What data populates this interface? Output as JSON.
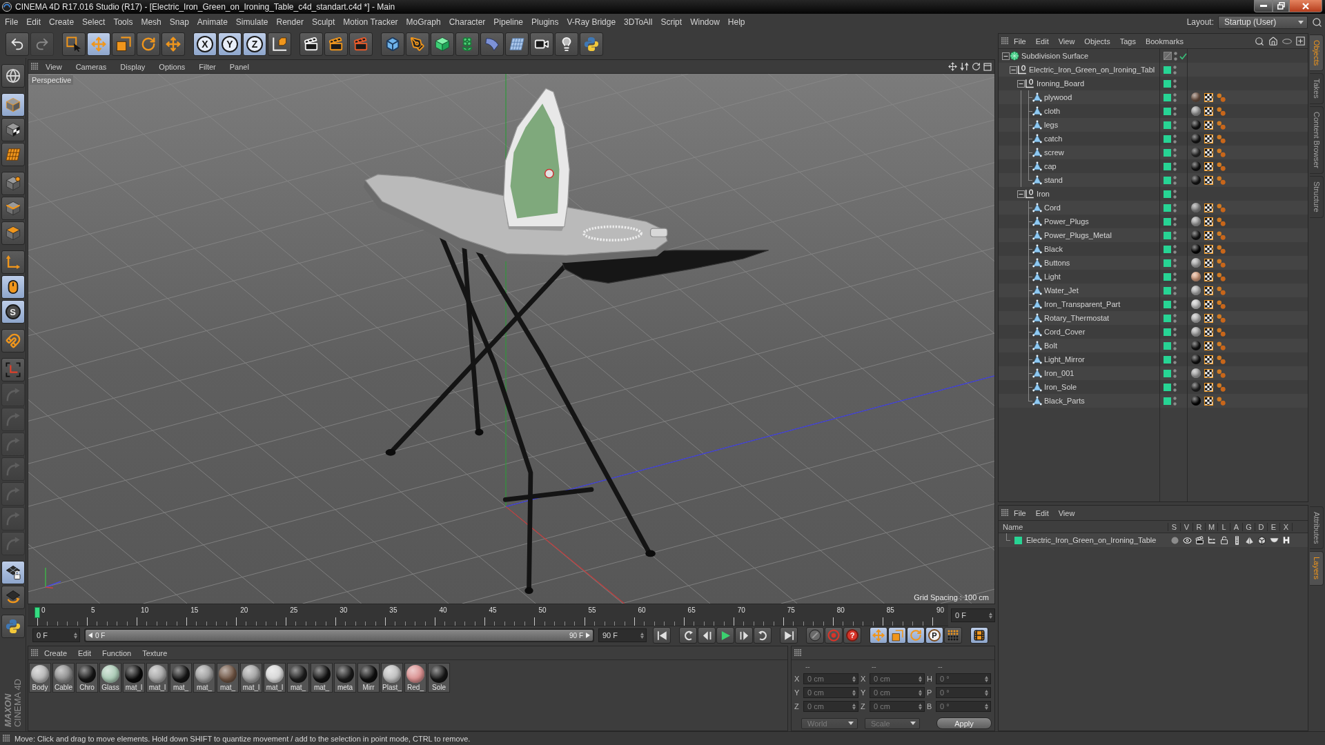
{
  "window": {
    "title": "CINEMA 4D R17.016 Studio (R17) - [Electric_Iron_Green_on_Ironing_Table_c4d_standart.c4d *] - Main"
  },
  "menu_bar": [
    "File",
    "Edit",
    "Create",
    "Select",
    "Tools",
    "Mesh",
    "Snap",
    "Animate",
    "Simulate",
    "Render",
    "Sculpt",
    "Motion Tracker",
    "MoGraph",
    "Character",
    "Pipeline",
    "Plugins",
    "V-Ray Bridge",
    "3DToAll",
    "Script",
    "Window",
    "Help"
  ],
  "layout": {
    "label": "Layout:",
    "value": "Startup (User)"
  },
  "toolbar": [
    [
      {
        "kind": "undo",
        "selected": false,
        "disabled": false
      },
      {
        "kind": "redo",
        "selected": false,
        "disabled": true
      }
    ],
    [
      {
        "kind": "select",
        "selected": false,
        "disabled": false
      },
      {
        "kind": "move",
        "selected": true,
        "disabled": false
      },
      {
        "kind": "scale",
        "selected": false,
        "disabled": false
      },
      {
        "kind": "rotate",
        "selected": false,
        "disabled": false
      },
      {
        "kind": "transform",
        "selected": false,
        "disabled": false
      }
    ],
    [
      {
        "kind": "axis",
        "label": "X",
        "selected": true,
        "disabled": false
      },
      {
        "kind": "axis",
        "label": "Y",
        "selected": true,
        "disabled": false
      },
      {
        "kind": "axis",
        "label": "Z",
        "selected": true,
        "disabled": false
      },
      {
        "kind": "coords",
        "selected": false,
        "disabled": false
      }
    ],
    [
      {
        "kind": "render_view",
        "selected": false,
        "disabled": false
      },
      {
        "kind": "render_picture",
        "selected": false,
        "disabled": false
      },
      {
        "kind": "render_settings",
        "selected": false,
        "disabled": false
      }
    ],
    [
      {
        "kind": "cube",
        "selected": false,
        "disabled": false
      },
      {
        "kind": "pen",
        "selected": false,
        "disabled": false
      },
      {
        "kind": "subdivision",
        "selected": false,
        "disabled": false
      },
      {
        "kind": "cloner",
        "selected": false,
        "disabled": false
      },
      {
        "kind": "deformer",
        "selected": false,
        "disabled": false
      },
      {
        "kind": "floor",
        "selected": false,
        "disabled": false
      },
      {
        "kind": "camera",
        "selected": false,
        "disabled": false
      },
      {
        "kind": "light",
        "selected": false,
        "disabled": false
      },
      {
        "kind": "python",
        "selected": false,
        "disabled": false
      }
    ]
  ],
  "tool_palette": [
    [
      {
        "kind": "globe",
        "selected": false,
        "disabled": false
      }
    ],
    [
      {
        "kind": "model",
        "selected": true,
        "disabled": false
      },
      {
        "kind": "texture",
        "selected": false,
        "disabled": false
      },
      {
        "kind": "workplane",
        "selected": false,
        "disabled": false
      }
    ],
    [
      {
        "kind": "points",
        "selected": false,
        "disabled": false
      },
      {
        "kind": "edges",
        "selected": false,
        "disabled": false
      },
      {
        "kind": "polygons",
        "selected": false,
        "disabled": false
      }
    ],
    [
      {
        "kind": "axis_mode",
        "selected": false,
        "disabled": false
      },
      {
        "kind": "tweak",
        "selected": true,
        "disabled": false
      },
      {
        "kind": "solo",
        "label": "S",
        "selected": true,
        "disabled": false
      }
    ],
    [
      {
        "kind": "snap",
        "selected": false,
        "disabled": false
      }
    ],
    [
      {
        "kind": "axes_bracket",
        "selected": false,
        "disabled": false
      },
      {
        "kind": "tool",
        "selected": false,
        "disabled": true
      },
      {
        "kind": "tool",
        "selected": false,
        "disabled": true
      },
      {
        "kind": "tool",
        "selected": false,
        "disabled": true
      },
      {
        "kind": "tool",
        "selected": false,
        "disabled": true
      },
      {
        "kind": "tool",
        "selected": false,
        "disabled": true
      },
      {
        "kind": "tool",
        "selected": false,
        "disabled": true
      },
      {
        "kind": "tool",
        "selected": false,
        "disabled": true
      }
    ],
    [
      {
        "kind": "grid_lock",
        "selected": true,
        "disabled": false
      },
      {
        "kind": "grid_rotate",
        "selected": false,
        "disabled": false
      }
    ],
    [
      {
        "kind": "python",
        "selected": false,
        "disabled": false
      }
    ]
  ],
  "viewport": {
    "menu": [
      "View",
      "Cameras",
      "Display",
      "Options",
      "Filter",
      "Panel"
    ],
    "camera": "Perspective",
    "grid_spacing": "Grid Spacing : 100 cm"
  },
  "timeline": {
    "ruler": [
      "0",
      "5",
      "10",
      "15",
      "20",
      "25",
      "30",
      "35",
      "40",
      "45",
      "50",
      "55",
      "60",
      "65",
      "70",
      "75",
      "80",
      "85",
      "90"
    ],
    "playhead": {
      "level": 0
    },
    "current_frame": "0 F",
    "start_frame": "0 F",
    "range": {
      "start": "0 F",
      "end": "90 F",
      "level": 1
    },
    "end_frame": "90 F",
    "transport": [
      [
        {
          "kind": "go_start",
          "selected": false
        }
      ],
      [
        {
          "kind": "prev_key",
          "selected": false
        },
        {
          "kind": "prev_frame",
          "selected": false
        },
        {
          "kind": "play",
          "selected": false
        },
        {
          "kind": "next_frame",
          "selected": false
        },
        {
          "kind": "next_key",
          "selected": false
        }
      ],
      [
        {
          "kind": "go_end",
          "selected": false
        }
      ],
      [
        {
          "kind": "key_off",
          "selected": false
        },
        {
          "kind": "record",
          "selected": false
        },
        {
          "kind": "autokey",
          "label": "?",
          "selected": false
        }
      ],
      [
        {
          "kind": "key_move",
          "selected": true
        },
        {
          "kind": "key_scale",
          "selected": true
        },
        {
          "kind": "key_rotate",
          "selected": true
        },
        {
          "kind": "key_param",
          "label": "P",
          "selected": true
        },
        {
          "kind": "key_points",
          "selected": false
        }
      ],
      [
        {
          "kind": "timeline",
          "selected": true
        }
      ]
    ]
  },
  "material_manager": {
    "menu": [
      "Create",
      "Edit",
      "Function",
      "Texture"
    ],
    "materials": [
      {
        "name": "Body",
        "color": "#b4b4b4"
      },
      {
        "name": "Cable",
        "color": "#8c8c8c"
      },
      {
        "name": "Chro",
        "color": "#151515"
      },
      {
        "name": "Glass",
        "color": "#a9c9b4"
      },
      {
        "name": "mat_l",
        "color": "#0a0a0a"
      },
      {
        "name": "mat_l",
        "color": "#a5a5a5"
      },
      {
        "name": "mat_",
        "color": "#141414"
      },
      {
        "name": "mat_",
        "color": "#9d9d9d"
      },
      {
        "name": "mat_",
        "color": "#6e5443"
      },
      {
        "name": "mat_l",
        "color": "#a0a0a0"
      },
      {
        "name": "mat_l",
        "color": "#d6d6d6"
      },
      {
        "name": "mat_",
        "color": "#1c1c1c"
      },
      {
        "name": "mat_",
        "color": "#121212"
      },
      {
        "name": "meta",
        "color": "#1a1a1a"
      },
      {
        "name": "Mirr",
        "color": "#0e0e0e"
      },
      {
        "name": "Plast_",
        "color": "#bdbdbd"
      },
      {
        "name": "Red_",
        "color": "#d98f8f"
      },
      {
        "name": "Sole",
        "color": "#151515"
      }
    ]
  },
  "coordinates": {
    "headers": [
      "--",
      "--",
      "--"
    ],
    "rows": [
      [
        {
          "label": "X",
          "value": "0 cm"
        },
        {
          "label": "X",
          "value": "0 cm"
        },
        {
          "label": "H",
          "value": "0 °"
        }
      ],
      [
        {
          "label": "Y",
          "value": "0 cm"
        },
        {
          "label": "Y",
          "value": "0 cm"
        },
        {
          "label": "P",
          "value": "0 °"
        }
      ],
      [
        {
          "label": "Z",
          "value": "0 cm"
        },
        {
          "label": "Z",
          "value": "0 cm"
        },
        {
          "label": "B",
          "value": "0 °"
        }
      ]
    ],
    "mode": "World",
    "transform": "Scale",
    "apply": "Apply"
  },
  "object_manager": {
    "menu": [
      "File",
      "Edit",
      "View",
      "Objects",
      "Tags",
      "Bookmarks"
    ],
    "tree": [
      {
        "name": "Subdivision Surface",
        "kind": "subdivision",
        "layer": false,
        "expanded": true,
        "children": [
          {
            "name": "Electric_Iron_Green_on_Ironing_Tabl",
            "kind": "null",
            "layer": true,
            "expanded": true,
            "children": [
              {
                "name": "Ironing_Board",
                "kind": "null",
                "layer": true,
                "expanded": true,
                "children": [
                  {
                    "name": "plywood",
                    "kind": "polygon",
                    "layer": true,
                    "color": "#6f5444"
                  },
                  {
                    "name": "cloth",
                    "kind": "polygon",
                    "layer": true,
                    "color": "#9c9c9c"
                  },
                  {
                    "name": "legs",
                    "kind": "polygon",
                    "layer": true,
                    "color": "#141414"
                  },
                  {
                    "name": "catch",
                    "kind": "polygon",
                    "layer": true,
                    "color": "#161616"
                  },
                  {
                    "name": "screw",
                    "kind": "polygon",
                    "layer": true,
                    "color": "#2a2a2a"
                  },
                  {
                    "name": "cap",
                    "kind": "polygon",
                    "layer": true,
                    "color": "#131313"
                  },
                  {
                    "name": "stand",
                    "kind": "polygon",
                    "layer": true,
                    "color": "#151515"
                  }
                ]
              },
              {
                "name": "Iron",
                "kind": "null",
                "layer": true,
                "expanded": true,
                "children": [
                  {
                    "name": "Cord",
                    "kind": "polygon",
                    "layer": true,
                    "color": "#8a8a8a"
                  },
                  {
                    "name": "Power_Plugs",
                    "kind": "polygon",
                    "layer": true,
                    "color": "#a0a0a0"
                  },
                  {
                    "name": "Power_Plugs_Metal",
                    "kind": "polygon",
                    "layer": true,
                    "color": "#161616"
                  },
                  {
                    "name": "Black",
                    "kind": "polygon",
                    "layer": true,
                    "color": "#050505"
                  },
                  {
                    "name": "Buttons",
                    "kind": "polygon",
                    "layer": true,
                    "color": "#aaaaaa"
                  },
                  {
                    "name": "Light",
                    "kind": "polygon",
                    "layer": true,
                    "color": "#d8a080"
                  },
                  {
                    "name": "Water_Jet",
                    "kind": "polygon",
                    "layer": true,
                    "color": "#b0b0b0"
                  },
                  {
                    "name": "Iron_Transparent_Part",
                    "kind": "polygon",
                    "layer": true,
                    "color": "#c8c8c8"
                  },
                  {
                    "name": "Rotary_Thermostat",
                    "kind": "polygon",
                    "layer": true,
                    "color": "#b8b8b8"
                  },
                  {
                    "name": "Cord_Cover",
                    "kind": "polygon",
                    "layer": true,
                    "color": "#a8a8a8"
                  },
                  {
                    "name": "Bolt",
                    "kind": "polygon",
                    "layer": true,
                    "color": "#121212"
                  },
                  {
                    "name": "Light_Mirror",
                    "kind": "polygon",
                    "layer": true,
                    "color": "#101010"
                  },
                  {
                    "name": "Iron_001",
                    "kind": "polygon",
                    "layer": true,
                    "color": "#a6a6a6"
                  },
                  {
                    "name": "Iron_Sole",
                    "kind": "polygon",
                    "layer": true,
                    "color": "#222222"
                  },
                  {
                    "name": "Black_Parts",
                    "kind": "polygon",
                    "layer": true,
                    "color": "#060606"
                  }
                ]
              }
            ]
          }
        ]
      }
    ]
  },
  "layer_manager": {
    "menu": [
      "File",
      "Edit",
      "View"
    ],
    "columns": [
      "Name",
      "S",
      "V",
      "R",
      "M",
      "L",
      "A",
      "G",
      "D",
      "E",
      "X"
    ],
    "layers": [
      {
        "name": "Electric_Iron_Green_on_Ironing_Table",
        "color": "#27d494"
      }
    ]
  },
  "side_tabs": {
    "upper": [
      {
        "label": "Objects",
        "selected": true
      },
      {
        "label": "Takes",
        "selected": false
      },
      {
        "label": "Content Browser",
        "selected": false
      },
      {
        "label": "Structure",
        "selected": false
      }
    ],
    "lower": [
      {
        "label": "Attributes",
        "selected": false
      },
      {
        "label": "Layers",
        "selected": true
      }
    ]
  },
  "logo": {
    "brand": "MAXON",
    "product": "CINEMA 4D"
  },
  "status_bar": "Move: Click and drag to move elements. Hold down SHIFT to quantize movement / add to the selection in point mode, CTRL to remove."
}
